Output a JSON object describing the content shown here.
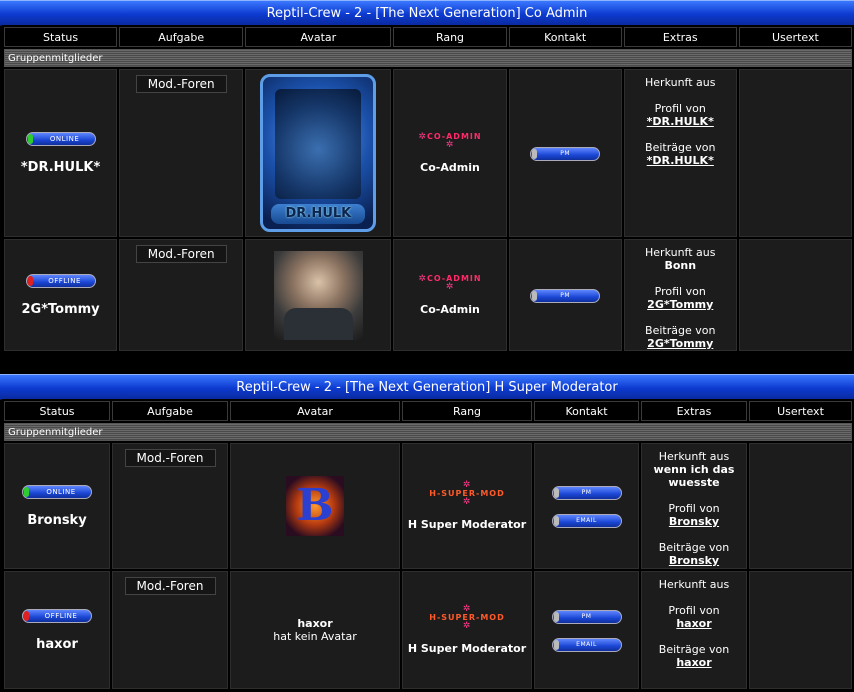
{
  "sections": [
    {
      "title": "Reptil-Crew - 2 - [The Next Generation] Co Admin",
      "columns": [
        "Status",
        "Aufgabe",
        "Avatar",
        "Rang",
        "Kontakt",
        "Extras",
        "Usertext"
      ],
      "group_label": "Gruppenmitglieder",
      "members": [
        {
          "status": "ONLINE",
          "name": "*DR.HULK*",
          "aufgabe": "Mod.-Foren",
          "avatar_text": "DR.HULK",
          "rank_image_text": "CO-ADMIN",
          "rank": "Co-Admin",
          "contact": [
            "PM"
          ],
          "herkunft_label": "Herkunft aus",
          "herkunft_value": "",
          "profil_label": "Profil von",
          "profil_link": "*DR.HULK*",
          "beitraege_label": "Beiträge von",
          "beitraege_link": "*DR.HULK*"
        },
        {
          "status": "OFFLINE",
          "name": "2G*Tommy",
          "aufgabe": "Mod.-Foren",
          "rank_image_text": "CO-ADMIN",
          "rank": "Co-Admin",
          "contact": [
            "PM"
          ],
          "herkunft_label": "Herkunft aus",
          "herkunft_value": "Bonn",
          "profil_label": "Profil von",
          "profil_link": "2G*Tommy",
          "beitraege_label": "Beiträge von",
          "beitraege_link": "2G*Tommy"
        }
      ]
    },
    {
      "title": "Reptil-Crew - 2 - [The Next Generation] H Super Moderator",
      "columns": [
        "Status",
        "Aufgabe",
        "Avatar",
        "Rang",
        "Kontakt",
        "Extras",
        "Usertext"
      ],
      "group_label": "Gruppenmitglieder",
      "members": [
        {
          "status": "ONLINE",
          "name": "Bronsky",
          "aufgabe": "Mod.-Foren",
          "avatar_text": "B",
          "rank_image_text": "H-SUPER-MOD",
          "rank": "H Super Moderator",
          "contact": [
            "PM",
            "EMAIL"
          ],
          "herkunft_label": "Herkunft aus",
          "herkunft_value": "wenn ich das wuesste",
          "profil_label": "Profil von",
          "profil_link": "Bronsky",
          "beitraege_label": "Beiträge von",
          "beitraege_link": "Bronsky"
        },
        {
          "status": "OFFLINE",
          "name": "haxor",
          "aufgabe": "Mod.-Foren",
          "no_avatar_name": "haxor",
          "no_avatar_text": "hat kein Avatar",
          "rank_image_text": "H-SUPER-MOD",
          "rank": "H Super Moderator",
          "contact": [
            "PM",
            "EMAIL"
          ],
          "herkunft_label": "Herkunft aus",
          "herkunft_value": "",
          "profil_label": "Profil von",
          "profil_link": "haxor",
          "beitraege_label": "Beiträge von",
          "beitraege_link": "haxor"
        }
      ]
    }
  ],
  "colors": {
    "title_bar": "#1a46d4",
    "online_led": "#2ecc2e",
    "offline_led": "#e02020",
    "rank_text": "#ff2a6a"
  }
}
